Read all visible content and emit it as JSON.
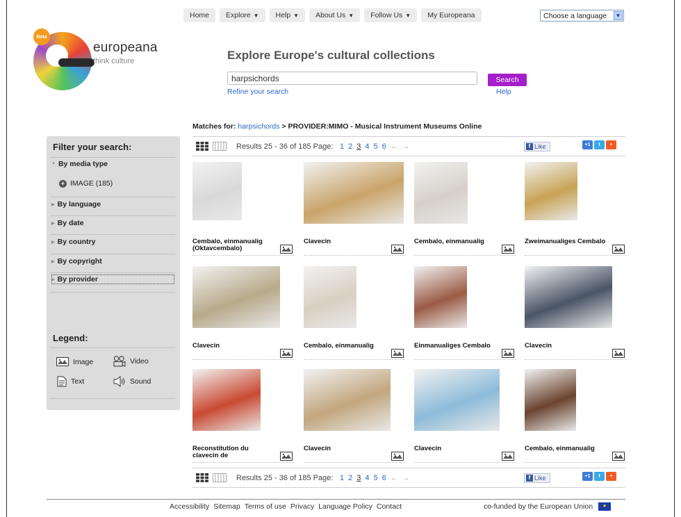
{
  "nav": {
    "items": [
      {
        "label": "Home",
        "caret": false
      },
      {
        "label": "Explore",
        "caret": true
      },
      {
        "label": "Help",
        "caret": true
      },
      {
        "label": "About Us",
        "caret": true
      },
      {
        "label": "Follow Us",
        "caret": true
      },
      {
        "label": "My Europeana",
        "caret": false
      }
    ],
    "language_select": "Choose a language"
  },
  "logo": {
    "name": "europeana",
    "tagline": "think culture",
    "badge": "Beta"
  },
  "header": {
    "title": "Explore Europe's cultural collections",
    "search_value": "harpsichords",
    "search_button": "Search",
    "refine_link": "Refine your search",
    "help_link": "Help"
  },
  "matches": {
    "prefix": "Matches for:",
    "query": "harpsichords",
    "sep": ">",
    "provider": "PROVIDER:MIMO - Musical Instrument Museums Online"
  },
  "sidebar": {
    "filter_title": "Filter your search:",
    "facets": [
      {
        "label": "By media type",
        "expanded": true
      },
      {
        "label": "By language",
        "expanded": false
      },
      {
        "label": "By date",
        "expanded": false
      },
      {
        "label": "By country",
        "expanded": false
      },
      {
        "label": "By copyright",
        "expanded": false
      },
      {
        "label": "By provider",
        "expanded": false
      }
    ],
    "media_type_option": "IMAGE (185)",
    "legend_title": "Legend:",
    "legend": [
      {
        "label": "Image",
        "icon": "image-icon"
      },
      {
        "label": "Video",
        "icon": "video-icon"
      },
      {
        "label": "Text",
        "icon": "text-icon"
      },
      {
        "label": "Sound",
        "icon": "sound-icon"
      }
    ]
  },
  "results_bar": {
    "results_text": "Results 25 - 36 of 185 Page:",
    "pages": [
      "1",
      "2",
      "3",
      "4",
      "5",
      "6"
    ],
    "current_page": "3",
    "prev_arrow": "←",
    "next_arrow": "→",
    "like_label": "Like",
    "plus_one": "+1"
  },
  "results": [
    {
      "title": "Cembalo, einmanualig (Oktavcembalo)",
      "type": "image-icon",
      "thumb_color": "#d9d9d9"
    },
    {
      "title": "Clavecin",
      "type": "image-icon",
      "thumb_color": "#c9a46a"
    },
    {
      "title": "Cembalo, einmanualig",
      "type": "image-icon",
      "thumb_color": "#d6d0c8"
    },
    {
      "title": "Zweimanualiges Cembalo",
      "type": "image-icon",
      "thumb_color": "#c8a356"
    },
    {
      "title": "Clavecin",
      "type": "image-icon",
      "thumb_color": "#b7a98a"
    },
    {
      "title": "Cembalo, einmanualig",
      "type": "image-icon",
      "thumb_color": "#d9cfc2"
    },
    {
      "title": "Einmanualiges Cembalo",
      "type": "image-icon",
      "thumb_color": "#9b5b45"
    },
    {
      "title": "Clavecin",
      "type": "image-icon",
      "thumb_color": "#4a5566"
    },
    {
      "title": "Reconstitution du clavecin de",
      "type": "image-icon",
      "thumb_color": "#c94a32"
    },
    {
      "title": "Clavecin",
      "type": "image-icon",
      "thumb_color": "#c2a67e"
    },
    {
      "title": "Clavecin",
      "type": "image-icon",
      "thumb_color": "#8dbbd9"
    },
    {
      "title": "Cembalo, einmanualig",
      "type": "image-icon",
      "thumb_color": "#6b4430"
    }
  ],
  "footer": {
    "links": [
      "Accessibility",
      "Sitemap",
      "Terms of use",
      "Privacy",
      "Language Policy",
      "Contact"
    ],
    "cofunded": "co-funded by the European Union"
  },
  "colors": {
    "link": "#2a66c8",
    "search_button": "#a51fcb",
    "sidebar_bg": "#dcdcdc"
  }
}
